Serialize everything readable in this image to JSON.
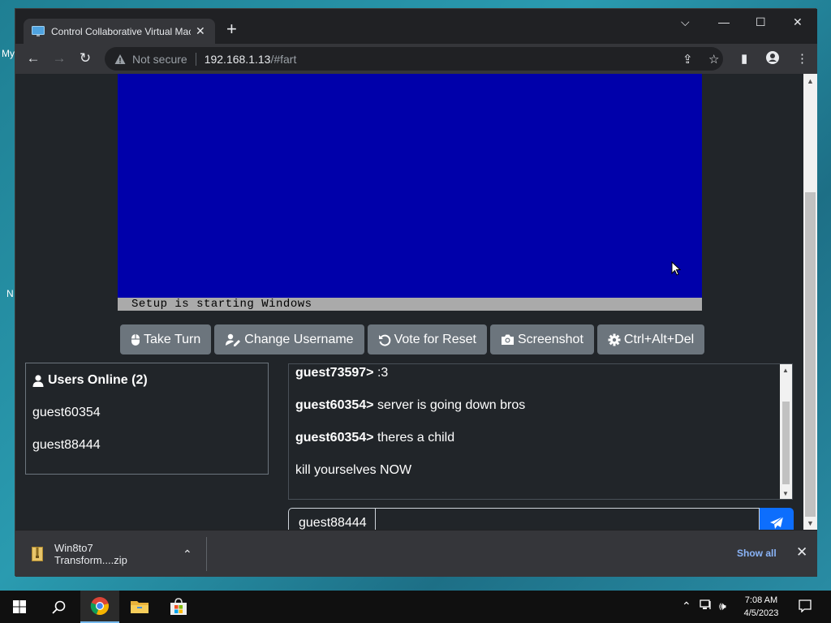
{
  "desktop": {
    "labels": [
      "My",
      "N"
    ]
  },
  "browser": {
    "tab_title": "Control Collaborative Virtual Machine",
    "new_tab_glyph": "+",
    "window_controls": {
      "chevron": "⌵",
      "minimize": "—",
      "maximize": "☐",
      "close": "✕"
    },
    "nav": {
      "back": "←",
      "forward": "→",
      "reload": "↻"
    },
    "security_label": "Not secure",
    "url_host": "192.168.1.13",
    "url_path": "/#fart"
  },
  "vm": {
    "status_text": "Setup is starting Windows",
    "screen_color": "#0000aa",
    "buttons": [
      {
        "label": "Take Turn",
        "icon": "mouse-icon"
      },
      {
        "label": "Change Username",
        "icon": "user-pen-icon"
      },
      {
        "label": "Vote for Reset",
        "icon": "rotate-left-icon"
      },
      {
        "label": "Screenshot",
        "icon": "camera-icon"
      },
      {
        "label": "Ctrl+Alt+Del",
        "icon": "gear-icon"
      }
    ]
  },
  "users": {
    "title": "Users Online (2)",
    "list": [
      "guest60354",
      "guest88444"
    ]
  },
  "chat": {
    "messages": [
      {
        "user": "guest73597>",
        "text": " :3"
      },
      {
        "user": "guest60354>",
        "text": " server is going down bros"
      },
      {
        "user": "guest60354>",
        "text": " theres a child"
      },
      {
        "user": "",
        "text": "kill yourselves NOW"
      }
    ],
    "username": "guest88444",
    "input_value": "",
    "send_color": "#0d6efd"
  },
  "downloads": {
    "file_name": "Win8to7 Transform....zip",
    "show_all": "Show all"
  },
  "taskbar": {
    "time": "7:08 AM",
    "date": "4/5/2023"
  }
}
